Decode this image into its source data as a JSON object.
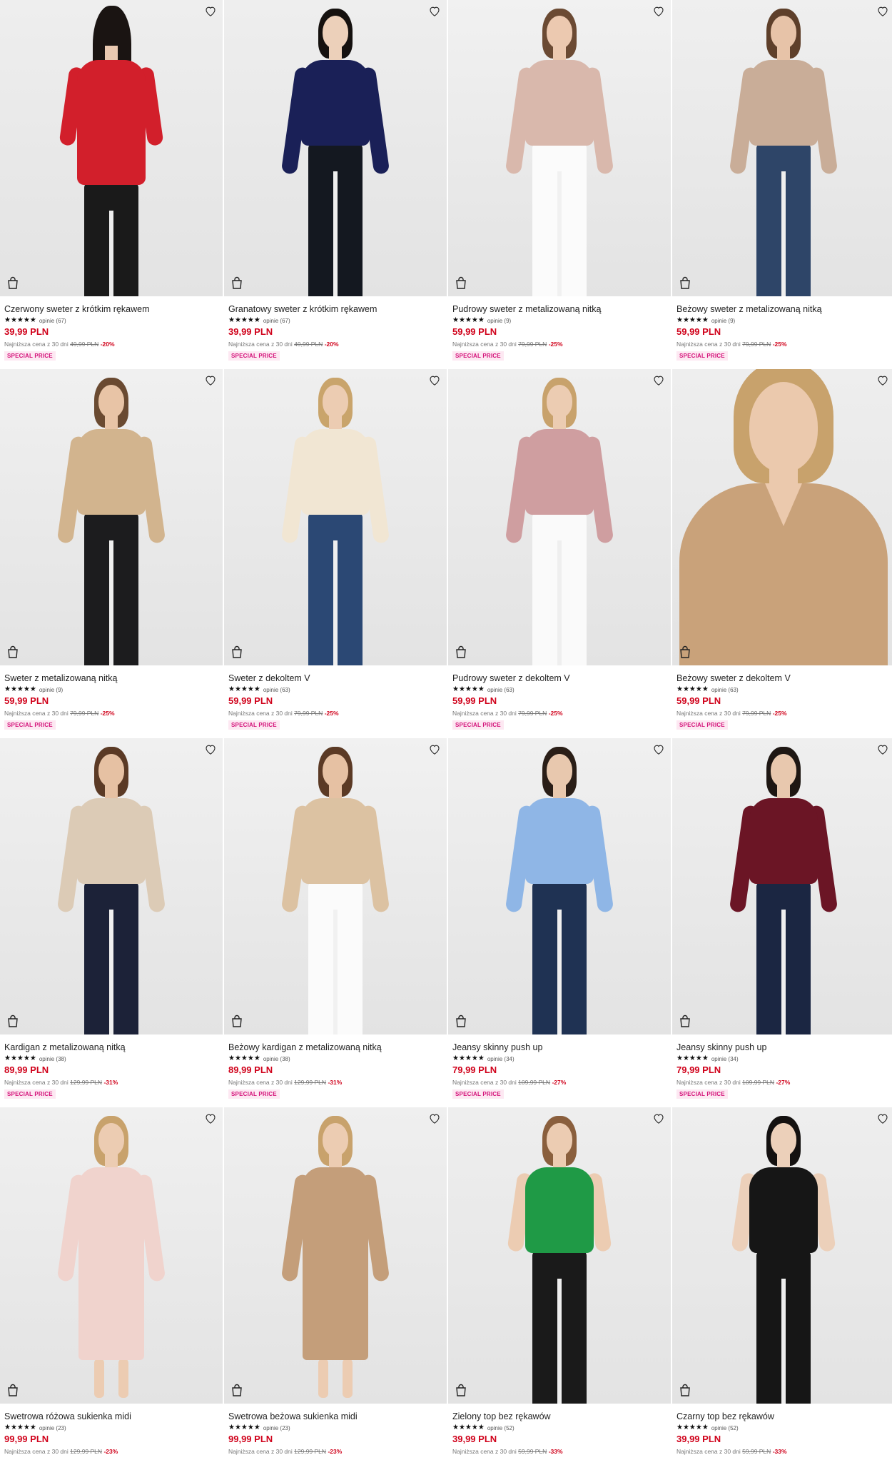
{
  "labels": {
    "reviews_word": "opinie",
    "lowest_prefix": "Najniższa cena z 30 dni",
    "stars": "★★★★★"
  },
  "products": [
    {
      "title": "Czerwony sweter z krótkim rękawem",
      "reviews": "(67)",
      "price": "39,99 PLN",
      "old_price": "49,99 PLN",
      "discount": "-20%",
      "badge": "SPECIAL PRICE",
      "top": "#d21f2b",
      "bottom": "#1a1a1a",
      "hair": "#1a1412",
      "skin": "#e9c9b1",
      "bg": "#eeeeee",
      "back": true
    },
    {
      "title": "Granatowy sweter z krótkim rękawem",
      "reviews": "(67)",
      "price": "39,99 PLN",
      "old_price": "49,99 PLN",
      "discount": "-20%",
      "badge": "SPECIAL PRICE",
      "top": "#1a2057",
      "bottom": "#141820",
      "hair": "#15110f",
      "skin": "#ecd0ba",
      "bg": "#eeeeee"
    },
    {
      "title": "Pudrowy sweter z metalizowaną nitką",
      "reviews": "(9)",
      "price": "59,99 PLN",
      "old_price": "79,99 PLN",
      "discount": "-25%",
      "badge": "SPECIAL PRICE",
      "top": "#d9b8ac",
      "bottom": "#fbfbfb",
      "hair": "#6b4a33",
      "skin": "#ecc9b0",
      "bg": "#f1f1f1"
    },
    {
      "title": "Beżowy sweter z metalizowaną nitką",
      "reviews": "(9)",
      "price": "59,99 PLN",
      "old_price": "79,99 PLN",
      "discount": "-25%",
      "badge": "SPECIAL PRICE",
      "top": "#c9ad98",
      "bottom": "#2e4568",
      "hair": "#5e3f2a",
      "skin": "#e7c3a8",
      "bg": "#efefef"
    },
    {
      "title": "Sweter z metalizowaną nitką",
      "reviews": "(9)",
      "price": "59,99 PLN",
      "old_price": "79,99 PLN",
      "discount": "-25%",
      "badge": "SPECIAL PRICE",
      "top": "#d2b48e",
      "bottom": "#1c1c1e",
      "hair": "#6a4a31",
      "skin": "#e8c4a6",
      "bg": "#f0f0f0"
    },
    {
      "title": "Sweter z dekoltem V",
      "reviews": "(63)",
      "price": "59,99 PLN",
      "old_price": "79,99 PLN",
      "discount": "-25%",
      "badge": "SPECIAL PRICE",
      "top": "#f1e6d3",
      "bottom": "#2b4874",
      "hair": "#c9a46b",
      "skin": "#ecccb2",
      "bg": "#efefef"
    },
    {
      "title": "Pudrowy sweter z dekoltem V",
      "reviews": "(63)",
      "price": "59,99 PLN",
      "old_price": "79,99 PLN",
      "discount": "-25%",
      "badge": "SPECIAL PRICE",
      "top": "#cf9ea0",
      "bottom": "#fafafa",
      "hair": "#c8a26c",
      "skin": "#ecccb2",
      "bg": "#efefef"
    },
    {
      "title": "Beżowy sweter z dekoltem V",
      "reviews": "(63)",
      "price": "59,99 PLN",
      "old_price": "79,99 PLN",
      "discount": "-25%",
      "badge": "SPECIAL PRICE",
      "top": "#c9a27a",
      "bottom": "#c9a27a",
      "hair": "#c8a26c",
      "skin": "#ebc9ad",
      "bg": "#eeeeee",
      "closeup": true
    },
    {
      "title": "Kardigan z metalizowaną nitką",
      "reviews": "(38)",
      "price": "89,99 PLN",
      "old_price": "129,99 PLN",
      "discount": "-31%",
      "badge": "SPECIAL PRICE",
      "top": "#dccbb6",
      "bottom": "#1c2238",
      "hair": "#5b3a25",
      "skin": "#e6c1a3",
      "bg": "#f0f0f0"
    },
    {
      "title": "Beżowy kardigan z metalizowaną nitką",
      "reviews": "(38)",
      "price": "89,99 PLN",
      "old_price": "129,99 PLN",
      "discount": "-31%",
      "badge": "SPECIAL PRICE",
      "top": "#dcc2a2",
      "bottom": "#fbfbfb",
      "hair": "#5b3a25",
      "skin": "#e6c1a3",
      "bg": "#f1f1f1"
    },
    {
      "title": "Jeansy skinny push up",
      "reviews": "(34)",
      "price": "79,99 PLN",
      "old_price": "109,99 PLN",
      "discount": "-27%",
      "badge": "SPECIAL PRICE",
      "top": "#8fb6e6",
      "bottom": "#1f3253",
      "hair": "#2a1e17",
      "skin": "#e8c8ae",
      "bg": "#f0f0f0"
    },
    {
      "title": "Jeansy skinny push up",
      "reviews": "(34)",
      "price": "79,99 PLN",
      "old_price": "109,99 PLN",
      "discount": "-27%",
      "badge": "SPECIAL PRICE",
      "top": "#6b1525",
      "bottom": "#1b2642",
      "hair": "#1e1713",
      "skin": "#e8c8ae",
      "bg": "#efefef"
    },
    {
      "title": "Swetrowa różowa sukienka midi",
      "reviews": "(23)",
      "price": "99,99 PLN",
      "old_price": "129,99 PLN",
      "discount": "-23%",
      "badge": "",
      "top": "#f0d3cd",
      "bottom": "#f0d3cd",
      "hair": "#c8a26c",
      "skin": "#ecccb2",
      "bg": "#f0f0f0",
      "dress": true
    },
    {
      "title": "Swetrowa beżowa sukienka midi",
      "reviews": "(23)",
      "price": "99,99 PLN",
      "old_price": "129,99 PLN",
      "discount": "-23%",
      "badge": "",
      "top": "#c49e7a",
      "bottom": "#c49e7a",
      "hair": "#c8a26c",
      "skin": "#ecccb2",
      "bg": "#efefef",
      "dress": true
    },
    {
      "title": "Zielony top bez rękawów",
      "reviews": "(52)",
      "price": "39,99 PLN",
      "old_price": "59,99 PLN",
      "discount": "-33%",
      "badge": "",
      "top": "#1f9a46",
      "bottom": "#1a1a1a",
      "hair": "#8a5f3d",
      "skin": "#ecccb2",
      "bg": "#eeeeee",
      "sleeveless": true
    },
    {
      "title": "Czarny top bez rękawów",
      "reviews": "(52)",
      "price": "39,99 PLN",
      "old_price": "59,99 PLN",
      "discount": "-33%",
      "badge": "",
      "top": "#161616",
      "bottom": "#161616",
      "hair": "#141110",
      "skin": "#ecd0ba",
      "bg": "#eeeeee",
      "sleeveless": true
    }
  ]
}
